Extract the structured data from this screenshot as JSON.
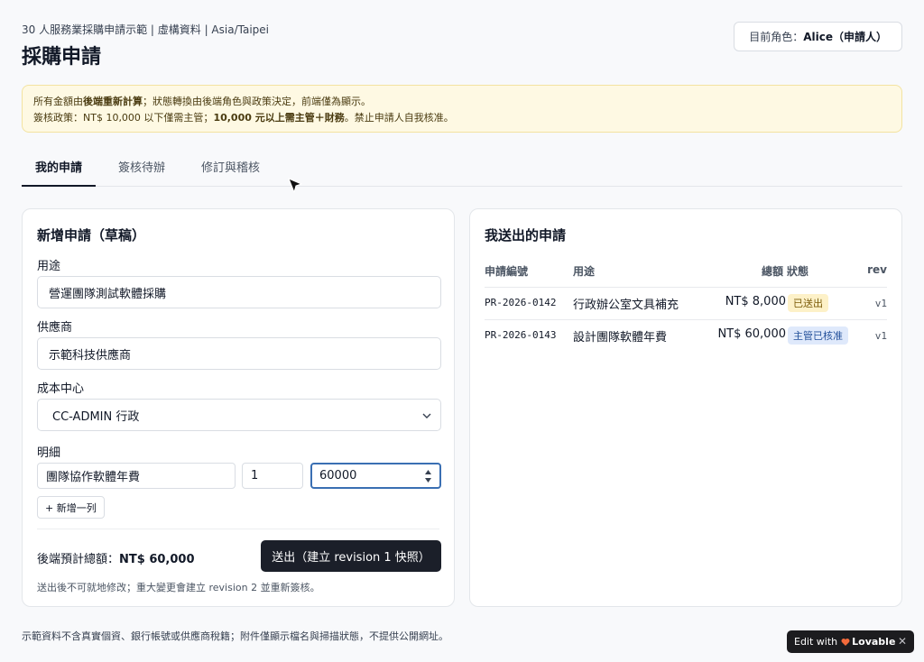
{
  "header": {
    "subtitle": "30 人服務業採購申請示範 | 虛構資料 | Asia/Taipei",
    "title": "採購申請",
    "role_prefix": "目前角色：",
    "role_name": "Alice（申請人）"
  },
  "notice": {
    "line1_a": "所有金額由",
    "line1_b": "後端重新計算",
    "line1_c": "；狀態轉換由後端角色與政策決定，前端僅為顯示。",
    "line2_a": "簽核政策：NT$ 10,000 以下僅需主管；",
    "line2_b": "10,000 元以上需主管＋財務",
    "line2_c": "。禁止申請人自我核准。"
  },
  "tabs": [
    {
      "label": "我的申請",
      "active": true
    },
    {
      "label": "簽核待辦",
      "active": false
    },
    {
      "label": "修訂與稽核",
      "active": false
    }
  ],
  "form": {
    "title": "新增申請（草稿）",
    "purpose_label": "用途",
    "purpose_value": "營運團隊測試軟體採購",
    "vendor_label": "供應商",
    "vendor_value": "示範科技供應商",
    "cost_center_label": "成本中心",
    "cost_center_value": "CC-ADMIN 行政",
    "items_label": "明細",
    "item_name": "團隊協作軟體年費",
    "item_qty": "1",
    "item_price": "60000",
    "add_row_label": "+ 新增一列",
    "total_label": "後端預計總額：",
    "total_value": "NT$ 60,000",
    "submit_label": "送出（建立 revision 1 快照）",
    "hint": "送出後不可就地修改；重大變更會建立 revision 2 並重新簽核。"
  },
  "list": {
    "title": "我送出的申請",
    "columns": {
      "id": "申請編號",
      "purpose": "用途",
      "amount": "總額",
      "status": "狀態",
      "rev": "rev"
    },
    "rows": [
      {
        "id": "PR-2026-0142",
        "purpose": "行政辦公室文具補充",
        "amount": "NT$ 8,000",
        "status": "已送出",
        "rev": "v1"
      },
      {
        "id": "PR-2026-0143",
        "purpose": "設計團隊軟體年費",
        "amount": "NT$ 60,000",
        "status": "主管已核准",
        "rev": "v1"
      }
    ]
  },
  "footer": "示範資料不含真實個資、銀行帳號或供應商稅籍；附件僅顯示檔名與掃描狀態，不提供公開網址。",
  "badge": {
    "prefix": "Edit with",
    "brand": "Lovable",
    "close": "✕"
  },
  "colors": {
    "accent": "#1b1f29",
    "notice_bg": "#fef9e3",
    "focus": "#3a6fb3",
    "sent_badge": "#fdf1c8",
    "approved_badge": "#dfe9fb"
  }
}
